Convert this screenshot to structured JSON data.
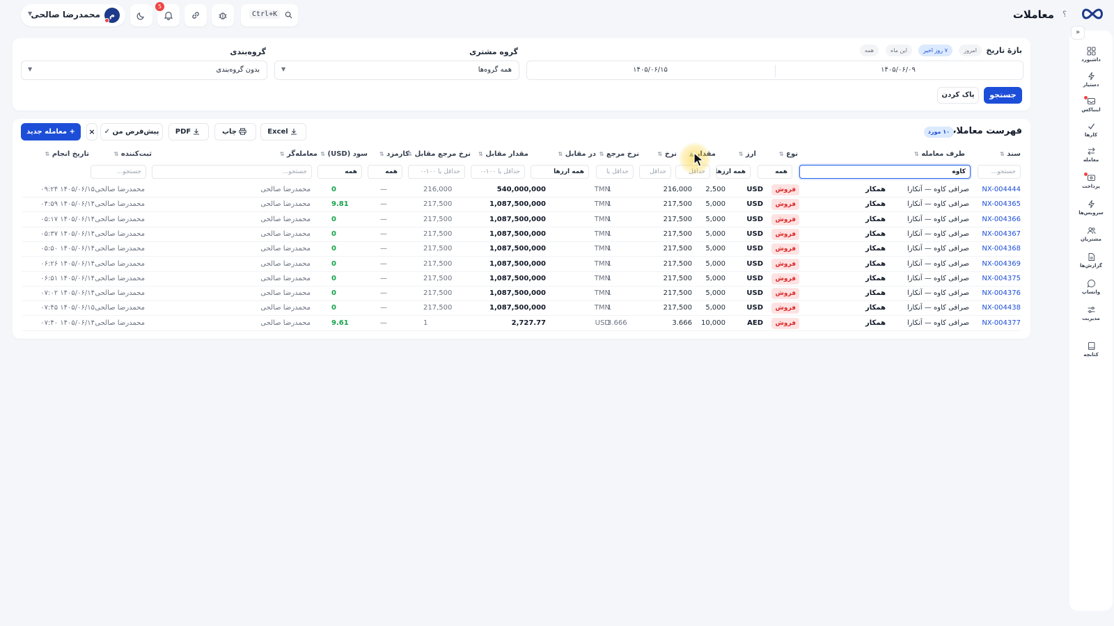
{
  "header": {
    "title": "معاملات",
    "help": "؟",
    "search_shortcut": "Ctrl+K",
    "notification_count": "5",
    "user": {
      "name": "محمدرضا صالحی",
      "initial": "م"
    }
  },
  "rail": {
    "toggle": "»",
    "items": [
      {
        "label": "داشبورد",
        "icon": "dashboard-icon"
      },
      {
        "label": "دستیار",
        "icon": "bolt-icon"
      },
      {
        "label": "اینباکس",
        "icon": "inbox-icon"
      },
      {
        "label": "کارها",
        "icon": "check-icon"
      },
      {
        "label": "معامله",
        "icon": "exchange-icon"
      },
      {
        "label": "پرداخت",
        "icon": "wallet-icon"
      },
      {
        "label": "سرویس‌ها",
        "icon": "bolt-icon"
      },
      {
        "label": "مشتریان",
        "icon": "users-icon"
      },
      {
        "label": "گزارش‌ها",
        "icon": "report-icon"
      },
      {
        "label": "واتساپ",
        "icon": "chat-icon"
      },
      {
        "label": "مدیریت",
        "icon": "sliders-icon"
      },
      {
        "label": "کتابچه",
        "icon": "book-icon"
      }
    ]
  },
  "filters": {
    "date_range_label": "بازهٔ تاریخ",
    "date_presets": [
      "امروز",
      "۷ روز اخیر",
      "این ماه",
      "همه"
    ],
    "date_from": "۱۴۰۵/۰۶/۰۹",
    "date_to": "۱۴۰۵/۰۶/۱۵",
    "customer_group_label": "گروه مشتری",
    "customer_group_value": "همه گروه‌ها",
    "grouping_label": "گروه‌بندی",
    "grouping_value": "بدون گروه‌بندی",
    "search_button": "جستجو",
    "clear_button": "پاک کردن"
  },
  "list": {
    "title": "فهرست معاملات",
    "count_badge": "۱۰ مورد",
    "new_button": "+ معامله جدید",
    "default_view_button": "پیش‌فرض من ✓",
    "close_x": "×",
    "pdf_button": "PDF",
    "print_button": "چاپ",
    "excel_button": "Excel"
  },
  "table": {
    "columns": {
      "doc": "سند",
      "party": "طرف معامله",
      "type": "نوع",
      "currency": "ارز",
      "amount": "مقدار",
      "rate": "نرخ",
      "ref_rate": "نرخ مرجع",
      "counter_currency": "در مقابل",
      "counter_amount": "مقدار مقابل",
      "counter_ref_rate": "نرخ مرجع مقابل",
      "fee": "کارمزد",
      "profit": "سود (USD)",
      "trader": "معامله‌گر",
      "registrar": "ثبت‌کننده",
      "date": "تاریخ انجام"
    },
    "filters": {
      "doc": "جستجو...",
      "party": "کاوه",
      "type": "همه",
      "currency": "همه ارزها",
      "amount": "حداقل",
      "rate": "حداقل",
      "ref_rate": "حداقل یا",
      "counter_currency": "همه ارزها",
      "counter_amount": "حداقل یا ۱۰۰-۰",
      "counter_ref_rate": "حداقل یا ۱۰۰-۰",
      "fee": "همه",
      "profit": "همه",
      "trader": "جستجو...",
      "registrar": "جستجو..."
    },
    "rows": [
      {
        "doc": "NX-004444",
        "party": "صرافی کاوه — آنکارا",
        "tag": "همکار",
        "type": "فروش",
        "currency": "USD",
        "amount": "2,500",
        "rate": "216,000",
        "ref_rate": "1",
        "counter_currency": "TMN",
        "counter_amount": "540,000,000",
        "counter_ref_rate": "216,000",
        "fee": "—",
        "profit": "0",
        "trader": "محمدرضا صالحی",
        "registrar": "محمدرضا صالحی",
        "date": "۱۴۰۵/۰۶/۱۵ ۰۹:۲۴"
      },
      {
        "doc": "NX-004365",
        "party": "صرافی کاوه — آنکارا",
        "tag": "همکار",
        "type": "فروش",
        "currency": "USD",
        "amount": "5,000",
        "rate": "217,500",
        "ref_rate": "1",
        "counter_currency": "TMN",
        "counter_amount": "1,087,500,000",
        "counter_ref_rate": "217,500",
        "fee": "—",
        "profit": "9.81",
        "trader": "محمدرضا صالحی",
        "registrar": "محمدرضا صالحی",
        "date": "۱۴۰۵/۰۶/۱۴ ۰۴:۵۹"
      },
      {
        "doc": "NX-004366",
        "party": "صرافی کاوه — آنکارا",
        "tag": "همکار",
        "type": "فروش",
        "currency": "USD",
        "amount": "5,000",
        "rate": "217,500",
        "ref_rate": "1",
        "counter_currency": "TMN",
        "counter_amount": "1,087,500,000",
        "counter_ref_rate": "217,500",
        "fee": "—",
        "profit": "0",
        "trader": "محمدرضا صالحی",
        "registrar": "محمدرضا صالحی",
        "date": "۱۴۰۵/۰۶/۱۴ ۰۵:۱۷"
      },
      {
        "doc": "NX-004367",
        "party": "صرافی کاوه — آنکارا",
        "tag": "همکار",
        "type": "فروش",
        "currency": "USD",
        "amount": "5,000",
        "rate": "217,500",
        "ref_rate": "1",
        "counter_currency": "TMN",
        "counter_amount": "1,087,500,000",
        "counter_ref_rate": "217,500",
        "fee": "—",
        "profit": "0",
        "trader": "محمدرضا صالحی",
        "registrar": "محمدرضا صالحی",
        "date": "۱۴۰۵/۰۶/۱۴ ۰۵:۳۷"
      },
      {
        "doc": "NX-004368",
        "party": "صرافی کاوه — آنکارا",
        "tag": "همکار",
        "type": "فروش",
        "currency": "USD",
        "amount": "5,000",
        "rate": "217,500",
        "ref_rate": "1",
        "counter_currency": "TMN",
        "counter_amount": "1,087,500,000",
        "counter_ref_rate": "217,500",
        "fee": "—",
        "profit": "0",
        "trader": "محمدرضا صالحی",
        "registrar": "محمدرضا صالحی",
        "date": "۱۴۰۵/۰۶/۱۴ ۰۵:۵۰"
      },
      {
        "doc": "NX-004369",
        "party": "صرافی کاوه — آنکارا",
        "tag": "همکار",
        "type": "فروش",
        "currency": "USD",
        "amount": "5,000",
        "rate": "217,500",
        "ref_rate": "1",
        "counter_currency": "TMN",
        "counter_amount": "1,087,500,000",
        "counter_ref_rate": "217,500",
        "fee": "—",
        "profit": "0",
        "trader": "محمدرضا صالحی",
        "registrar": "محمدرضا صالحی",
        "date": "۱۴۰۵/۰۶/۱۴ ۰۶:۲۶"
      },
      {
        "doc": "NX-004375",
        "party": "صرافی کاوه — آنکارا",
        "tag": "همکار",
        "type": "فروش",
        "currency": "USD",
        "amount": "5,000",
        "rate": "217,500",
        "ref_rate": "1",
        "counter_currency": "TMN",
        "counter_amount": "1,087,500,000",
        "counter_ref_rate": "217,500",
        "fee": "—",
        "profit": "0",
        "trader": "محمدرضا صالحی",
        "registrar": "محمدرضا صالحی",
        "date": "۱۴۰۵/۰۶/۱۴ ۰۶:۵۱"
      },
      {
        "doc": "NX-004376",
        "party": "صرافی کاوه — آنکارا",
        "tag": "همکار",
        "type": "فروش",
        "currency": "USD",
        "amount": "5,000",
        "rate": "217,500",
        "ref_rate": "1",
        "counter_currency": "TMN",
        "counter_amount": "1,087,500,000",
        "counter_ref_rate": "217,500",
        "fee": "—",
        "profit": "0",
        "trader": "محمدرضا صالحی",
        "registrar": "محمدرضا صالحی",
        "date": "۱۴۰۵/۰۶/۱۴ ۰۷:۰۲"
      },
      {
        "doc": "NX-004438",
        "party": "صرافی کاوه — آنکارا",
        "tag": "همکار",
        "type": "فروش",
        "currency": "USD",
        "amount": "5,000",
        "rate": "217,500",
        "ref_rate": "1",
        "counter_currency": "TMN",
        "counter_amount": "1,087,500,000",
        "counter_ref_rate": "217,500",
        "fee": "—",
        "profit": "0",
        "trader": "محمدرضا صالحی",
        "registrar": "محمدرضا صالحی",
        "date": "۱۴۰۵/۰۶/۱۵ ۰۷:۴۵"
      },
      {
        "doc": "NX-004377",
        "party": "صرافی کاوه — آنکارا",
        "tag": "همکار",
        "type": "فروش",
        "currency": "AED",
        "amount": "10,000",
        "rate": "3.666",
        "ref_rate": "3.666",
        "counter_currency": "USD",
        "counter_amount": "2,727.77",
        "counter_ref_rate": "1",
        "fee": "—",
        "profit": "9.61",
        "trader": "محمدرضا صالحی",
        "registrar": "محمدرضا صالحی",
        "date": "۱۴۰۵/۰۶/۱۴ ۰۷:۴۰"
      }
    ]
  },
  "colors": {
    "accent": "#1d4ed8",
    "sell_badge_bg": "#fee2e2",
    "sell_badge_text": "#dc2626",
    "profit_positive": "#16a34a",
    "cursor_highlight": "#facc15"
  }
}
